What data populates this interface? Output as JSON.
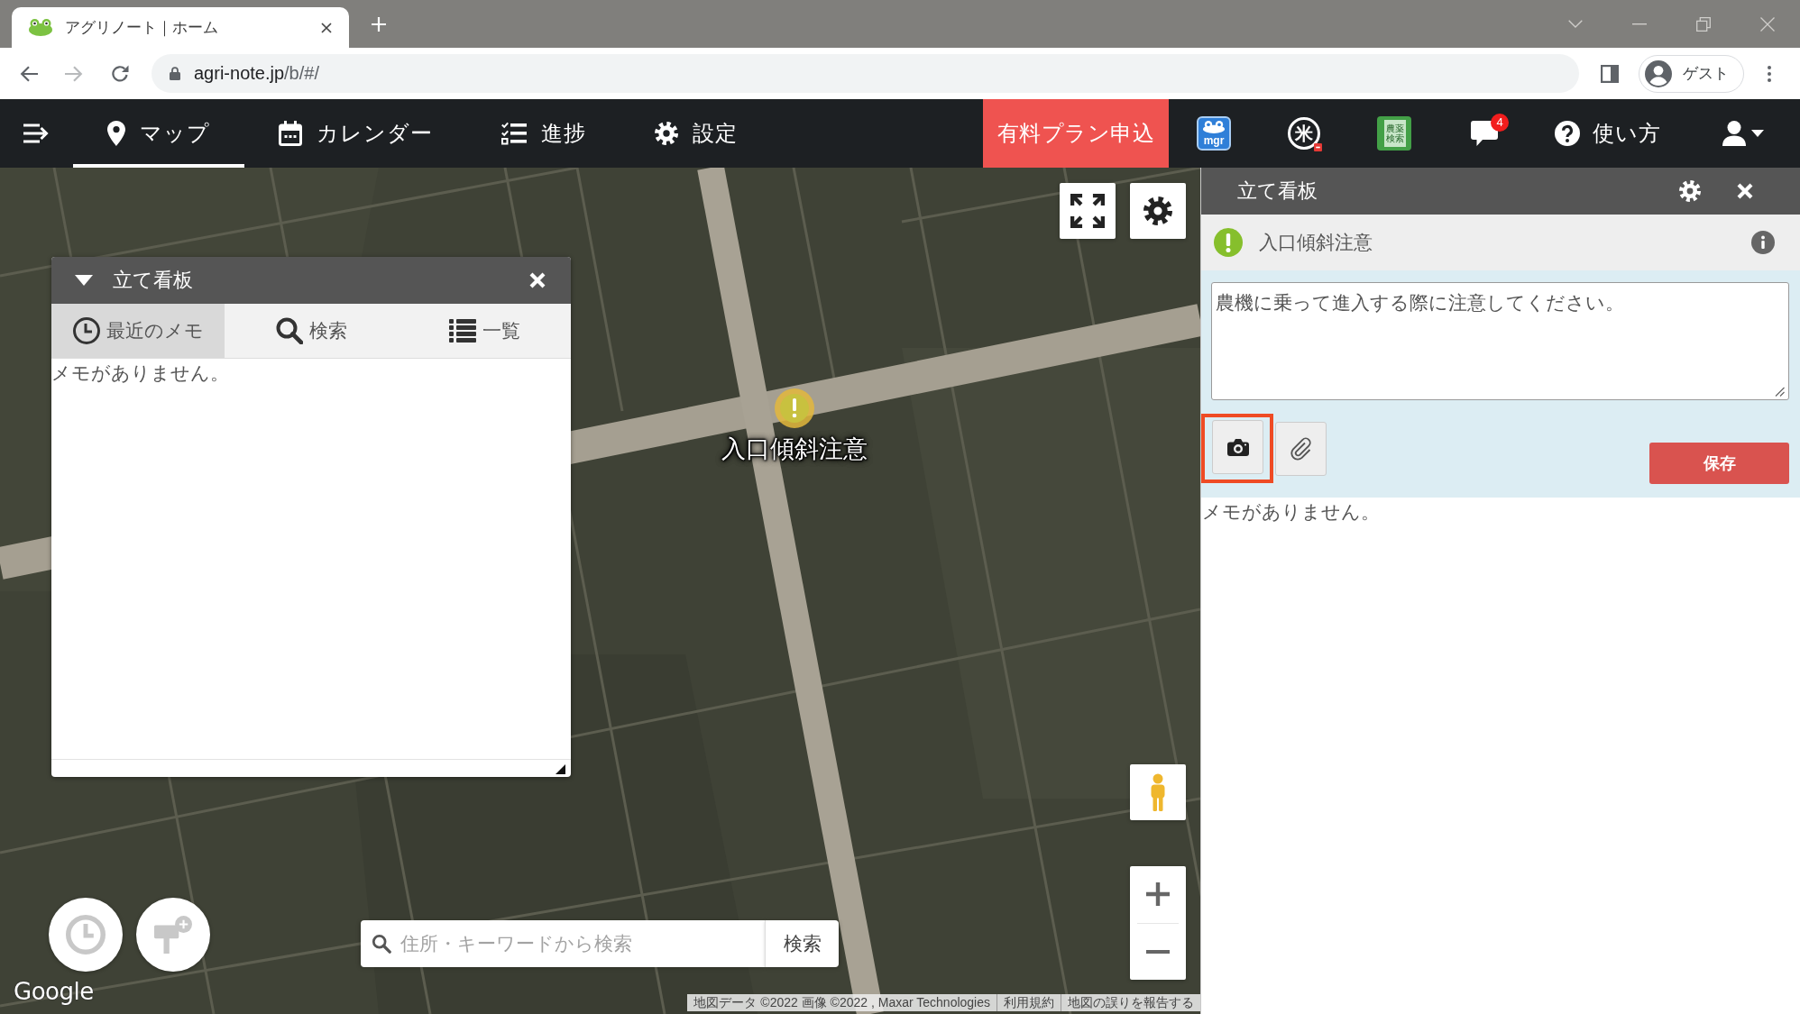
{
  "browser": {
    "tab": {
      "title": "アグリノート｜ホーム"
    },
    "address": {
      "host": "agri-note.jp",
      "path": "/b/#/"
    },
    "profile": "ゲスト"
  },
  "nav": {
    "tabs": [
      {
        "label": "マップ",
        "kind": "pin",
        "selected": true
      },
      {
        "label": "カレンダー",
        "kind": "calendar",
        "selected": false
      },
      {
        "label": "進捗",
        "kind": "checklist",
        "selected": false
      },
      {
        "label": "設定",
        "kind": "gear",
        "selected": false
      }
    ],
    "plan_button": "有料プラン申込",
    "apps": [
      {
        "kind": "mgr",
        "label": "mgr"
      },
      {
        "kind": "rice",
        "label": "米"
      },
      {
        "kind": "book",
        "label": "農薬検索"
      },
      {
        "kind": "chat",
        "badge": "4"
      }
    ],
    "help": "使い方"
  },
  "map": {
    "marker": {
      "label": "入口傾斜注意"
    },
    "panel": {
      "title": "立て看板",
      "expanded": true,
      "tabs": [
        {
          "label": "最近のメモ",
          "kind": "clock",
          "selected": true
        },
        {
          "label": "検索",
          "kind": "search",
          "selected": false
        },
        {
          "label": "一覧",
          "kind": "list",
          "selected": false
        }
      ],
      "empty_text": "メモがありません。"
    },
    "search": {
      "placeholder": "住所・キーワードから検索",
      "button": "検索"
    },
    "logo": "Google",
    "attribution": [
      "地図データ ©2022 画像 ©2022 , Maxar Technologies",
      "利用規約",
      "地図の誤りを報告する"
    ]
  },
  "side_panel": {
    "title": "立て看板",
    "sign": "入口傾斜注意",
    "memo": "農機に乗って進入する際に注意してください。",
    "tools": [
      {
        "kind": "camera",
        "highlighted": true
      },
      {
        "kind": "clip",
        "highlighted": false
      }
    ],
    "save": "保存",
    "empty_text": "メモがありません。"
  }
}
